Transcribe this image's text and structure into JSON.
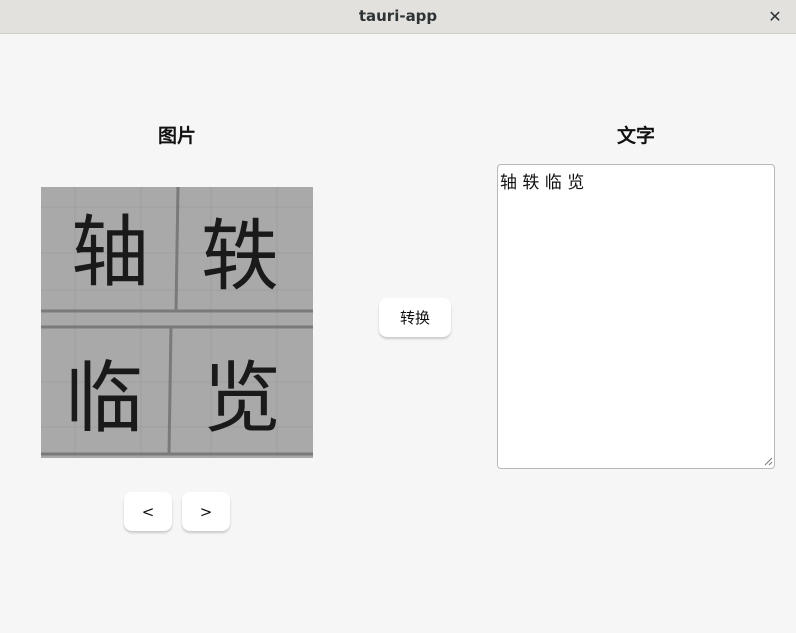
{
  "window": {
    "title": "tauri-app",
    "close_glyph": "✕",
    "close_icon": "close-icon"
  },
  "left_panel": {
    "heading": "图片",
    "image": {
      "characters": [
        "轴",
        "轶",
        "临",
        "览"
      ],
      "background_color": "#a9a9a9",
      "ink_color": "#1a1a1a"
    },
    "prev_label": "<",
    "next_label": ">"
  },
  "center": {
    "convert_label": "转换"
  },
  "right_panel": {
    "heading": "文字",
    "text_value": "轴 轶 临 览"
  }
}
